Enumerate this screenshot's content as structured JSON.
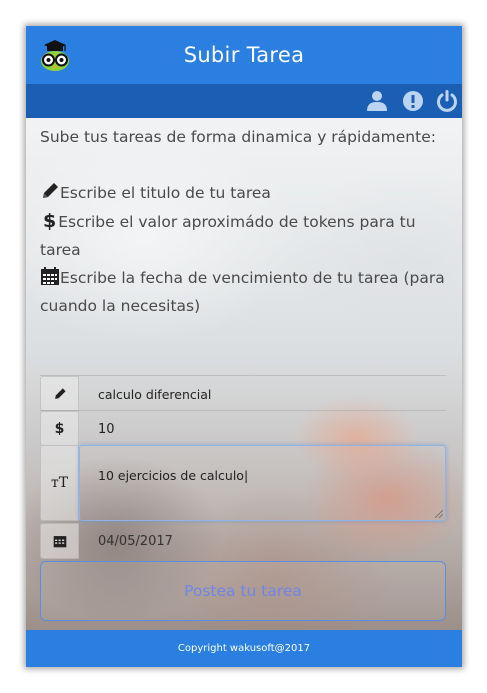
{
  "header": {
    "title": "Subir Tarea",
    "logo_icon": "owl-graduate-icon",
    "accent_color": "#2a7fe0",
    "subbar_color": "#1a5fb3"
  },
  "toolbar": {
    "icons": [
      "user-icon",
      "info-icon",
      "power-icon"
    ]
  },
  "intro": {
    "heading": "Sube tus tareas de forma dinamica y rápidamente:",
    "item_title": "Escribe el titulo de tu tarea",
    "item_tokens_1": "Escribe el valor aproximádo de tokens para tu",
    "item_tokens_2": "tarea",
    "item_date_1": "Escribe la fecha de vencimiento de tu tarea (para",
    "item_date_2": "cuando la necesitas)"
  },
  "form": {
    "title_value": "calculo diferencial",
    "tokens_symbol": "$",
    "tokens_value": "10",
    "textarea_icon_text": "тT",
    "description_value": "10 ejercicios de calculo|",
    "date_value": "04/05/2017",
    "submit_label": "Postea tu tarea"
  },
  "footer": {
    "copyright": "Copyright wakusoft@2017"
  }
}
